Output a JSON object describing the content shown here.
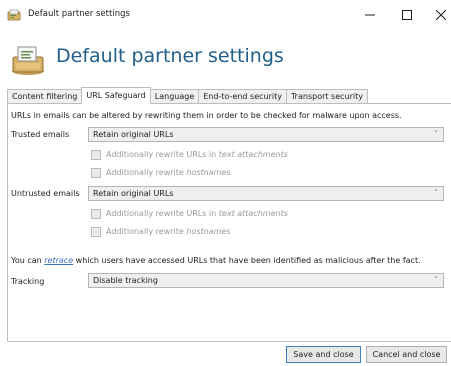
{
  "window": {
    "title": "Default partner settings",
    "minimize": "—",
    "maximize": "☐",
    "close": "✕"
  },
  "header": {
    "title": "Default partner settings",
    "icon": "partner-settings-icon"
  },
  "tabs": [
    {
      "label": "Content filtering",
      "active": false
    },
    {
      "label": "URL Safeguard",
      "active": true
    },
    {
      "label": "Language",
      "active": false
    },
    {
      "label": "End-to-end security",
      "active": false
    },
    {
      "label": "Transport security",
      "active": false
    }
  ],
  "panel": {
    "intro": "URLs in emails can be altered by rewriting them in order to be checked for malware upon access.",
    "trusted": {
      "label": "Trusted emails",
      "value": "Retain original URLs",
      "opt1_prefix": "Additionally rewrite URLs in ",
      "opt1_italic": "text attachments",
      "opt2_prefix": "Additionally rewrite ",
      "opt2_italic": "hostnames"
    },
    "untrusted": {
      "label": "Untrusted emails",
      "value": "Retain original URLs",
      "opt1_prefix": "Additionally rewrite URLs in ",
      "opt1_italic": "text attachments",
      "opt2_prefix": "Additionally rewrite ",
      "opt2_italic": "hostnames"
    },
    "retrace_prefix": "You can ",
    "retrace_link": "retrace",
    "retrace_suffix": " which users have accessed URLs that have been identified as malicious after the fact.",
    "tracking": {
      "label": "Tracking",
      "value": "Disable tracking"
    },
    "caret": "˅"
  },
  "buttons": {
    "save": "Save and close",
    "cancel": "Cancel and close"
  },
  "colors": {
    "header_title": "#1f5f8a",
    "link": "#3b6fb6",
    "primary_border": "#3c7fc4"
  }
}
